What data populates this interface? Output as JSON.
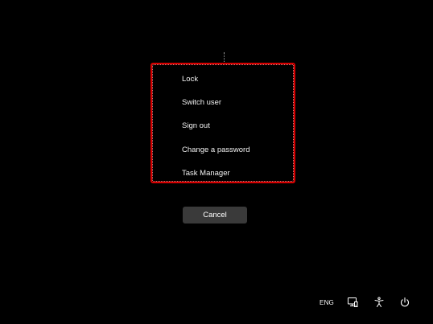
{
  "menu": {
    "items": [
      {
        "label": "Lock"
      },
      {
        "label": "Switch user"
      },
      {
        "label": "Sign out"
      },
      {
        "label": "Change a password"
      },
      {
        "label": "Task Manager"
      }
    ],
    "highlight_color": "#d90000"
  },
  "cancel": {
    "label": "Cancel"
  },
  "tray": {
    "language": "ENG",
    "icons": [
      "network-icon",
      "accessibility-icon",
      "power-icon"
    ]
  },
  "colors": {
    "background": "#000000",
    "button": "#3a3a3a",
    "text": "#ffffff"
  }
}
